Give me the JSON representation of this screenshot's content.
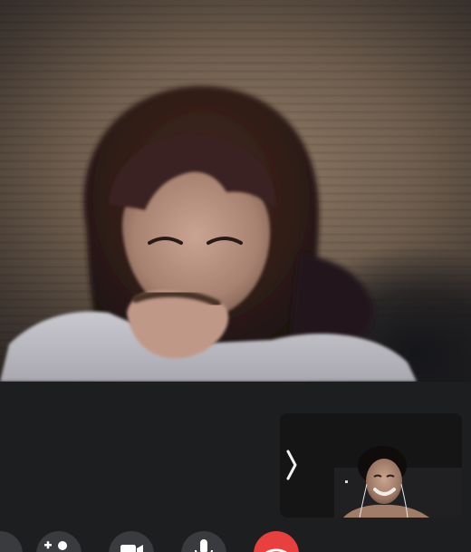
{
  "call": {
    "remote_video_label": "",
    "self_view_label": ""
  },
  "icons": {
    "collapse": "chevron-right-icon",
    "add_person": "add-person-icon",
    "video": "video-camera-icon",
    "mic": "microphone-icon",
    "end_call": "phone-hangup-icon"
  },
  "colors": {
    "end_call": "#e8403f",
    "control_button": "#3a3b3e",
    "background": "#1d1e20"
  }
}
